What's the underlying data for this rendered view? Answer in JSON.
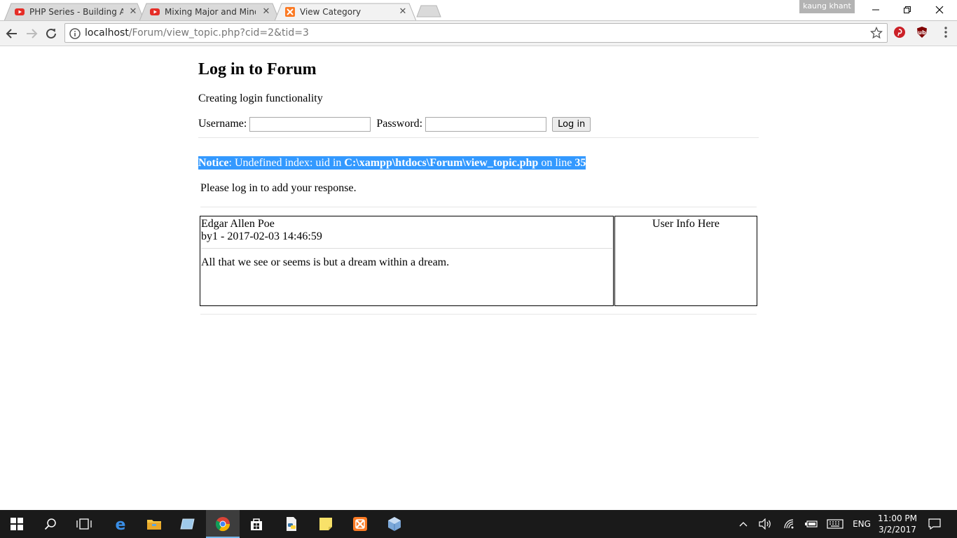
{
  "browser": {
    "tabs": [
      {
        "title": "PHP Series - Building A P",
        "favicon": "youtube-icon"
      },
      {
        "title": "Mixing Major and Minor",
        "favicon": "youtube-icon"
      },
      {
        "title": "View Category",
        "favicon": "xampp-icon"
      }
    ],
    "profile_name": "kaung khant",
    "url_host": "localhost",
    "url_path": "/Forum/view_topic.php?cid=2&tid=3"
  },
  "page": {
    "heading": "Log in to Forum",
    "subtitle": "Creating login functionality",
    "username_label": "Username:",
    "password_label": "Password:",
    "username_value": "",
    "password_value": "",
    "login_button": "Log in",
    "notice": {
      "label": "Notice",
      "text1": ": Undefined index: uid in ",
      "path": "C:\\xampp\\htdocs\\Forum\\view_topic.php",
      "text2": " on line ",
      "line": "35"
    },
    "please_login": "Please log in to add your response.",
    "post": {
      "title": "Edgar Allen Poe",
      "meta": "by1 - 2017-02-03 14:46:59",
      "body": "All that we see or seems is but a dream within a dream."
    },
    "user_info": "User Info Here"
  },
  "taskbar": {
    "language": "ENG",
    "time": "11:00 PM",
    "date": "3/2/2017"
  },
  "colors": {
    "notice_highlight": "#3399ff",
    "taskbar": "#1a1a1a",
    "active_accent": "#76b9ed"
  }
}
